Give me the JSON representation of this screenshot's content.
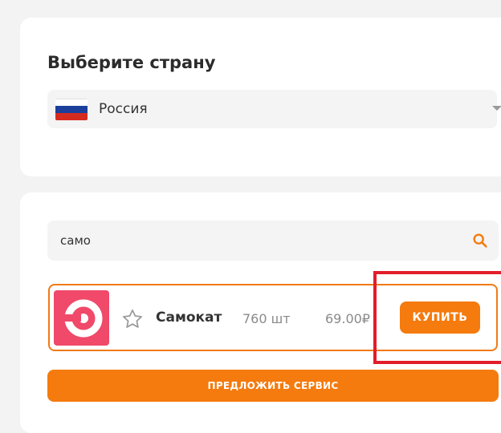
{
  "country_section": {
    "title": "Выберите страну",
    "selected_country": "Россия",
    "flag_colors": [
      "#ffffff",
      "#1c3f9c",
      "#d52b1e"
    ]
  },
  "search": {
    "value": "само",
    "icon": "search-icon"
  },
  "services": [
    {
      "name": "Самокат",
      "quantity": "760 шт",
      "price": "69.00₽",
      "buy_label": "КУПИТЬ",
      "logo_color": "#f04969"
    }
  ],
  "suggest_button": "ПРЕДЛОЖИТЬ СЕРВИС",
  "colors": {
    "accent": "#f57b0e",
    "highlight": "#e21d2a"
  }
}
